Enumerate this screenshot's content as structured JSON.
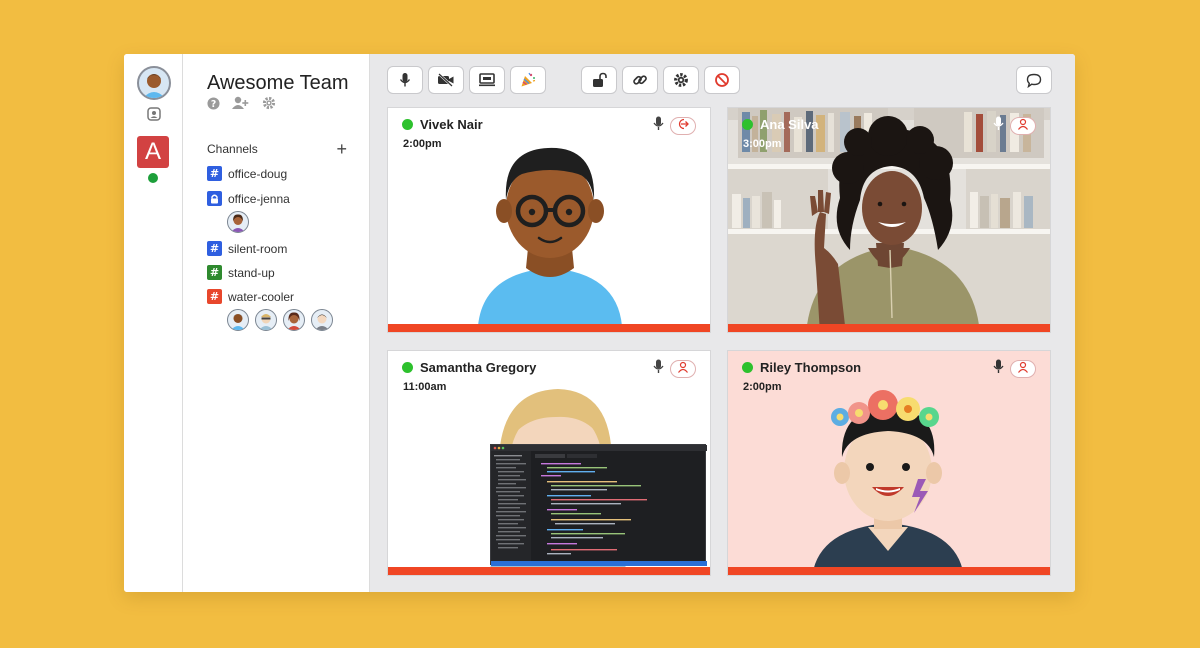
{
  "team": {
    "name": "Awesome Team",
    "badge_letter": "A"
  },
  "channels": {
    "label": "Channels",
    "add_label": "+",
    "items": [
      {
        "name": "office-doug",
        "icon": "hash-icon",
        "color": "#2f5fe0"
      },
      {
        "name": "office-jenna",
        "icon": "lock-icon",
        "color": "#2f5fe0"
      },
      {
        "name": "silent-room",
        "icon": "hash-icon",
        "color": "#2f5fe0"
      },
      {
        "name": "stand-up",
        "icon": "hash-icon",
        "color": "#2f8a2f"
      },
      {
        "name": "water-cooler",
        "icon": "hash-icon",
        "color": "#e8472c"
      }
    ]
  },
  "toolbar": {
    "left": [
      "microphone-icon",
      "video-off-icon",
      "screen-share-icon",
      "party-popper-icon"
    ],
    "middle": [
      "unlock-icon",
      "link-icon",
      "gear-icon",
      "block-icon"
    ],
    "right": [
      "chat-icon"
    ]
  },
  "participants": [
    {
      "name": "Vivek Nair",
      "time": "2:00pm"
    },
    {
      "name": "Ana Silva",
      "time": "3:00pm"
    },
    {
      "name": "Samantha Gregory",
      "time": "11:00am"
    },
    {
      "name": "Riley Thompson",
      "time": "2:00pm"
    }
  ],
  "colors": {
    "accent_bar": "#f04624",
    "online": "#2dc12d",
    "background": "#F2BD41"
  }
}
